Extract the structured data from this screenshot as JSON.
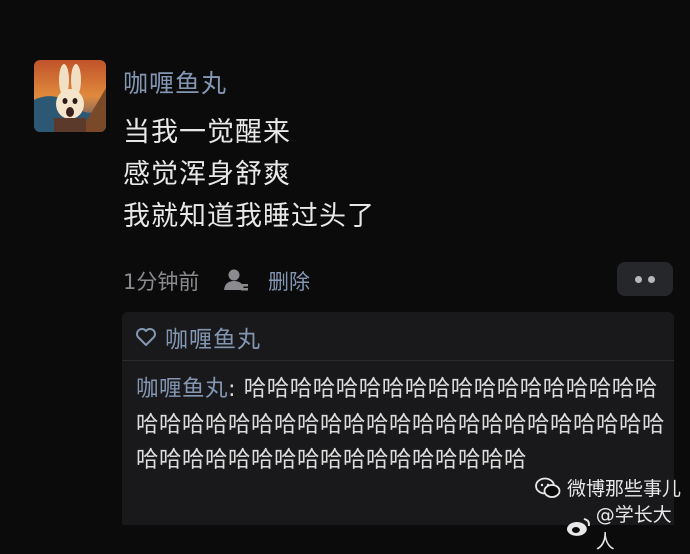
{
  "post": {
    "username": "咖喱鱼丸",
    "lines": [
      "当我一觉醒来",
      "感觉浑身舒爽",
      "我就知道我睡过头了"
    ],
    "time": "1分钟前",
    "delete_label": "删除"
  },
  "likes": {
    "liker": "咖喱鱼丸"
  },
  "comment": {
    "author": "咖喱鱼丸",
    "separator": ": ",
    "text": "哈哈哈哈哈哈哈哈哈哈哈哈哈哈哈哈哈哈哈哈哈哈哈哈哈哈哈哈哈哈哈哈哈哈哈哈哈哈哈哈哈哈哈哈哈哈哈哈哈哈哈哈哈哈哈哈哈哈"
  },
  "watermark": {
    "line1": "微博那些事儿",
    "line2": "@学长大人"
  }
}
